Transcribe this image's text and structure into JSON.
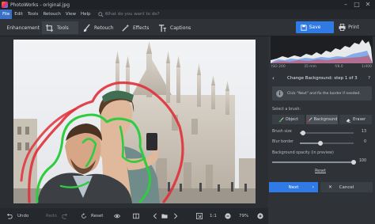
{
  "window": {
    "title": "PhotoWorks - original.jpg",
    "controls": [
      "–",
      "□",
      "✕"
    ]
  },
  "menu": {
    "items": [
      "File",
      "Edit",
      "Tools",
      "Retouch",
      "View",
      "Help"
    ],
    "active_index": 0,
    "search_placeholder": "What do you want to do?"
  },
  "toolbar": {
    "tabs": [
      {
        "label": "Enhancement",
        "icon": "sliders-icon"
      },
      {
        "label": "Tools",
        "icon": "crop-icon",
        "active": true
      },
      {
        "label": "Retouch",
        "icon": "brush-icon"
      },
      {
        "label": "Effects",
        "icon": "wand-icon"
      },
      {
        "label": "Captions",
        "icon": "text-icon"
      }
    ],
    "save_label": "Save",
    "print_label": "Print"
  },
  "bottom": {
    "undo": "Undo",
    "redo": "Redo",
    "reset": "Reset",
    "zoom_ratio": "1:1",
    "zoom_level": "79%"
  },
  "panel": {
    "exif": [
      "ISO 200",
      "35 mm",
      "f/8.0",
      "1/400"
    ],
    "step_title": "Change Background: step 1 of 3",
    "hint": "Click \"Next\" and fix the border if needed.",
    "select_brush_label": "Select a brush:",
    "brushes": [
      {
        "label": "Object",
        "active": false
      },
      {
        "label": "Background",
        "active": true
      },
      {
        "label": "Eraser",
        "active": false
      }
    ],
    "brush_size_label": "Brush size",
    "brush_size_value": "13",
    "brush_size_fraction": 0.06,
    "blur_border_label": "Blur border",
    "blur_border_value": "0",
    "blur_border_fraction": 0.38,
    "bg_opacity_label": "Background opacity (in preview)",
    "bg_opacity_value": "100",
    "bg_opacity_fraction": 1.0,
    "reset_label": "Reset",
    "next_label": "Next",
    "cancel_label": "Cancel"
  },
  "colors": {
    "accent": "#2f7ae5",
    "object_stroke": "#2ecc40",
    "background_stroke": "#e0303a"
  }
}
